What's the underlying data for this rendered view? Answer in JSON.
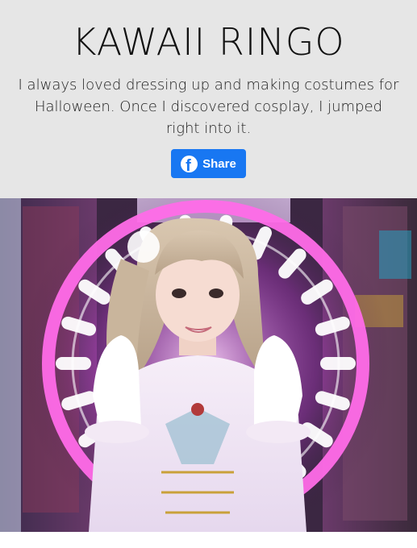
{
  "header": {
    "title": "KAWAII RINGO",
    "description": "I always loved dressing up and making costumes for Halloween. Once I discovered cosplay, I jumped right into it.",
    "share_label": "Share"
  },
  "colors": {
    "header_bg": "#e6e6e6",
    "share_button": "#1877f2",
    "neon_ring": "#ff4fe0"
  },
  "icons": {
    "share": "facebook-icon"
  }
}
